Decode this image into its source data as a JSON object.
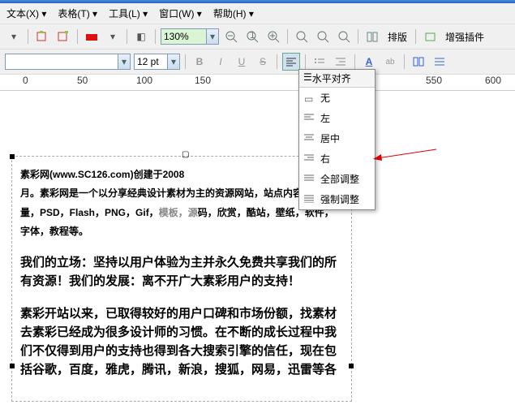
{
  "menu": {
    "text": "文本",
    "tbl": "表格",
    "tool": "工具",
    "win": "窗口",
    "help": "帮助",
    "text_k": "(X)",
    "tbl_k": "(T)",
    "tool_k": "(L)",
    "win_k": "(W)",
    "help_k": "(H)"
  },
  "tb1": {
    "zoom": "130%",
    "layout": "排版",
    "plugin": "增强插件"
  },
  "tb2": {
    "font": "",
    "size": "12 pt"
  },
  "align_menu": {
    "title": "水平对齐",
    "none": "无",
    "left": "左",
    "center": "居中",
    "right": "右",
    "justify": "全部调整",
    "force": "强制调整"
  },
  "ruler": {
    "t0": "0",
    "t1": "50",
    "t2": "100",
    "t3": "150",
    "t4": "550",
    "t5": "600"
  },
  "body": {
    "p1a": "素彩网(www.SC126.com)创建于2008",
    "p1b": "月。素彩网是一个以分享经典设计素材为主的资源网站，站点内容包括矢量，PSD，Flash，PNG，Gif，",
    "p1c": "模板，源",
    "p1d": "码，欣赏，酷站，壁纸，软件，字体，教程等。",
    "p2": "我们的立场：坚持以用户体验为主并永久免费共享我们的所有资源！我们的发展：离不开广大素彩用户的支持！",
    "p3": "素彩开站以来，已取得较好的用户口碑和市场份额，找素材去素彩已经成为很多设计师的习惯。在不断的成长过程中我们不仅得到用户的支持也得到各大搜索引擎的信任，现在包括谷歌，百度，雅虎，腾讯，新浪，搜狐，网易，迅雷等各"
  }
}
